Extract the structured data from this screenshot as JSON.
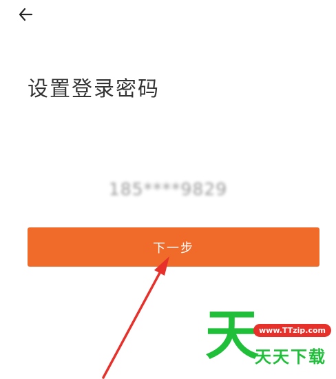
{
  "header": {
    "back_icon": "arrow-left-icon"
  },
  "page": {
    "title": "设置登录密码",
    "phone_masked": "185****9829"
  },
  "actions": {
    "next_label": "下一步"
  },
  "annotation": {
    "arrow_color": "#e8302a"
  },
  "watermark": {
    "logo_char": "天",
    "url": "www.TTzip.com",
    "name": "天天下载",
    "green": "#1fbf3a",
    "pill_red": "#e8302a"
  },
  "colors": {
    "primary": "#f06a2a",
    "title": "#333333",
    "phone": "#9a9a9a"
  }
}
